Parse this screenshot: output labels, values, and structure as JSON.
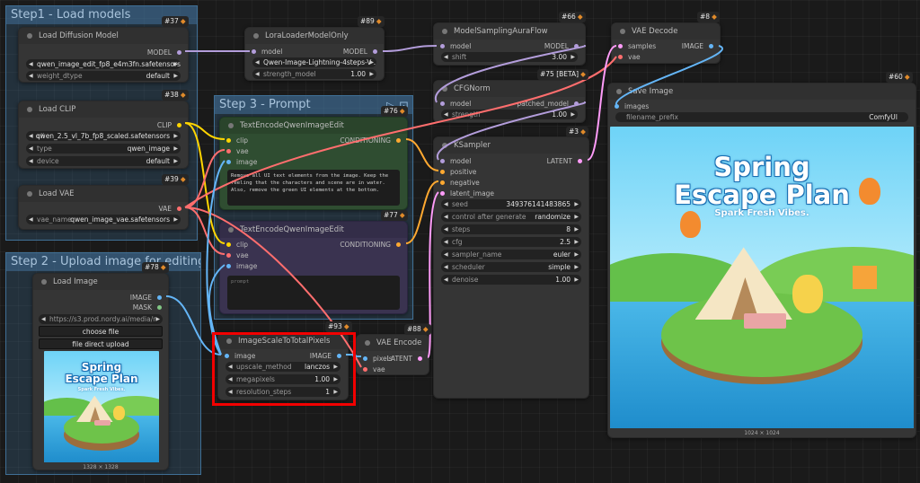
{
  "groups": {
    "step1": "Step1 - Load models",
    "step2": "Step 2 - Upload image for editing",
    "step3": "Step 3 - Prompt"
  },
  "nodes": {
    "load_diffusion": {
      "badge": "#37",
      "title": "Load Diffusion Model",
      "output": "MODEL",
      "unet_name": "qwen_image_edit_fp8_e4m3fn.safetensors",
      "weight_dtype_label": "weight_dtype",
      "weight_dtype_value": "default"
    },
    "load_clip": {
      "badge": "#38",
      "title": "Load CLIP",
      "output": "CLIP",
      "clip_label": "cli",
      "clip_value": "qwen_2.5_vl_7b_fp8_scaled.safetensors",
      "type_label": "type",
      "type_value": "qwen_image",
      "device_label": "device",
      "device_value": "default"
    },
    "load_vae": {
      "badge": "#39",
      "title": "Load VAE",
      "output": "VAE",
      "vae_label": "vae_name",
      "vae_value": "qwen_image_vae.safetensors"
    },
    "load_image": {
      "badge": "#78",
      "title": "Load Image",
      "out_image": "IMAGE",
      "out_mask": "MASK",
      "image_value": "https://s3.prod.nordy.ai/media/r",
      "choose_file": "choose file",
      "file_direct_upload": "file direct upload",
      "caption": "1328 × 1328"
    },
    "lora": {
      "badge": "#89",
      "title": "LoraLoaderModelOnly",
      "in_model": "model",
      "out_model": "MODEL",
      "lora_value": "Qwen-Image-Lightning-4steps-V ...",
      "strength_label": "strength_model",
      "strength_value": "1.00"
    },
    "model_sampling": {
      "badge": "#66",
      "title": "ModelSamplingAuraFlow",
      "in_model": "model",
      "out_model": "MODEL",
      "shift_label": "shift",
      "shift_value": "3.00"
    },
    "cfg_norm": {
      "badge": "#75 [BETA]",
      "title": "CFGNorm",
      "in_model": "model",
      "out_model": "patched_model",
      "strength_label": "strength",
      "strength_value": "1.00"
    },
    "vae_decode": {
      "badge": "#8",
      "title": "VAE Decode",
      "in_samples": "samples",
      "in_vae": "vae",
      "out_image": "IMAGE"
    },
    "save_image": {
      "badge": "#60",
      "title": "Save Image",
      "in_images": "images",
      "prefix_label": "filename_prefix",
      "prefix_value": "ComfyUI",
      "caption": "1024 × 1024"
    },
    "text_pos": {
      "badge": "#76",
      "title": "TextEncodeQwenImageEdit",
      "in_clip": "clip",
      "in_vae": "vae",
      "in_image": "image",
      "out": "CONDITIONING",
      "prompt": "Remove all UI text elements from the image. Keep the feeling that the characters and scene are in water. Also, remove the green UI elements at the bottom."
    },
    "text_neg": {
      "badge": "#77",
      "title": "TextEncodeQwenImageEdit",
      "in_clip": "clip",
      "in_vae": "vae",
      "in_image": "image",
      "out": "CONDITIONING",
      "placeholder": "prompt"
    },
    "ksampler": {
      "badge": "#3",
      "title": "KSampler",
      "in_model": "model",
      "in_positive": "positive",
      "in_negative": "negative",
      "in_latent": "latent_image",
      "out": "LATENT",
      "widgets": [
        {
          "label": "seed",
          "value": "349376141483865"
        },
        {
          "label": "control after generate",
          "value": "randomize"
        },
        {
          "label": "steps",
          "value": "8"
        },
        {
          "label": "cfg",
          "value": "2.5"
        },
        {
          "label": "sampler_name",
          "value": "euler"
        },
        {
          "label": "scheduler",
          "value": "simple"
        },
        {
          "label": "denoise",
          "value": "1.00"
        }
      ]
    },
    "image_scale": {
      "badge": "#93",
      "title": "ImageScaleToTotalPixels",
      "in_image": "image",
      "out_image": "IMAGE",
      "widgets": [
        {
          "label": "upscale_method",
          "value": "lanczos"
        },
        {
          "label": "megapixels",
          "value": "1.00"
        },
        {
          "label": "resolution_steps",
          "value": "1"
        }
      ]
    },
    "vae_encode": {
      "badge": "#88",
      "title": "VAE Encode",
      "in_pixels": "pixels",
      "in_vae": "vae",
      "out": "LATENT"
    }
  },
  "poster": {
    "title_line1": "Spring",
    "title_line2": "Escape Plan",
    "subtitle": "Spark Fresh Vibes."
  },
  "colors": {
    "model": "#b39ddb",
    "clip": "#ffd500",
    "vae": "#ff6e6e",
    "conditioning": "#ffa931",
    "latent": "#ff9cf9",
    "image": "#64b5f6",
    "highlight": "#f20000"
  }
}
